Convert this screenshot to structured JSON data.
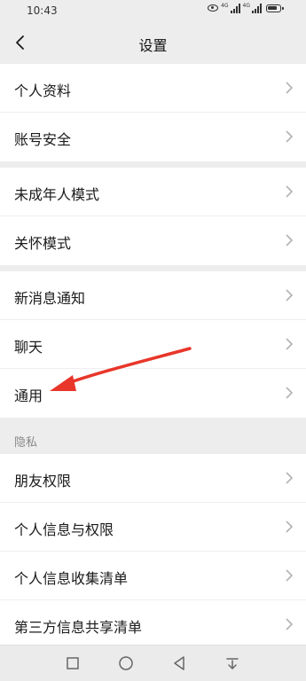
{
  "status_bar": {
    "time": "10:43",
    "network_label_1": "4G",
    "network_label_2": "4G"
  },
  "header": {
    "title": "设置",
    "back_icon": "chevron-left-icon"
  },
  "groups": [
    {
      "items": [
        {
          "label": "个人资料"
        },
        {
          "label": "账号安全"
        }
      ]
    },
    {
      "items": [
        {
          "label": "未成年人模式"
        },
        {
          "label": "关怀模式"
        }
      ]
    },
    {
      "items": [
        {
          "label": "新消息通知"
        },
        {
          "label": "聊天"
        },
        {
          "label": "通用"
        }
      ]
    },
    {
      "section_title": "隐私",
      "items": [
        {
          "label": "朋友权限"
        },
        {
          "label": "个人信息与权限"
        },
        {
          "label": "个人信息收集清单"
        },
        {
          "label": "第三方信息共享清单"
        }
      ]
    }
  ],
  "annotation": {
    "type": "red-arrow",
    "target": "通用",
    "color": "#e8362a"
  },
  "bottom_nav": {
    "icons": [
      "square-icon",
      "circle-icon",
      "triangle-back-icon",
      "download-arrow-icon"
    ]
  },
  "colors": {
    "background": "#ededed",
    "card": "#ffffff",
    "chevron": "#b2b2b2",
    "text": "#1a1a1a"
  }
}
